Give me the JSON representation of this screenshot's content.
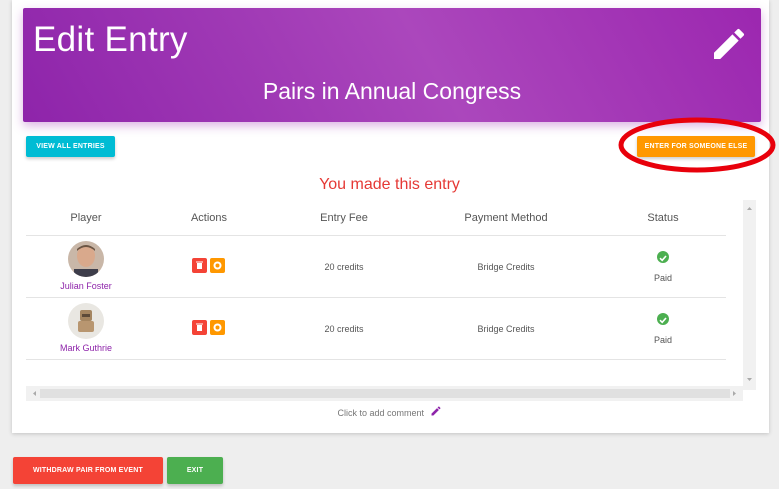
{
  "header": {
    "title": "Edit Entry",
    "subtitle": "Pairs in Annual Congress",
    "edit_icon": "pencil-icon",
    "gradient": [
      "#8e24aa",
      "#ab47bc"
    ]
  },
  "toolbar": {
    "view_all_label": "VIEW ALL ENTRIES",
    "enter_someone_label": "ENTER FOR SOMEONE ELSE"
  },
  "notice": "You made this entry",
  "table": {
    "columns": [
      "Player",
      "Actions",
      "Entry Fee",
      "Payment Method",
      "Status"
    ],
    "rows": [
      {
        "player": "Julian Foster",
        "avatar": "person-photo",
        "actions": [
          "trash-icon",
          "credits-icon"
        ],
        "entry_fee": "20 credits",
        "payment_method": "Bridge Credits",
        "status": "Paid",
        "status_icon": "check-circle-icon"
      },
      {
        "player": "Mark Guthrie",
        "avatar": "teddy-bear-photo",
        "actions": [
          "trash-icon",
          "credits-icon"
        ],
        "entry_fee": "20 credits",
        "payment_method": "Bridge Credits",
        "status": "Paid",
        "status_icon": "check-circle-icon"
      }
    ]
  },
  "comment": {
    "label": "Click to add comment",
    "icon": "pencil-icon"
  },
  "footer": {
    "withdraw_label": "WITHDRAW PAIR FROM EVENT",
    "exit_label": "EXIT"
  },
  "colors": {
    "cyan": "#00bcd4",
    "orange": "#ff9800",
    "red": "#f44336",
    "green": "#4caf50",
    "purple": "#8e24aa"
  }
}
